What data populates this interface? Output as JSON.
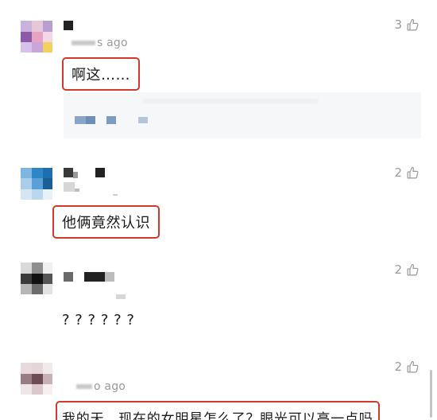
{
  "comments": [
    {
      "time": "s ago",
      "likes": "3",
      "text": "啊这……"
    },
    {
      "time": "",
      "likes": "2",
      "text": "他俩竟然认识"
    },
    {
      "time": "",
      "likes": "2",
      "text": "? ? ? ? ? ?"
    },
    {
      "time": "o ago",
      "likes": "2",
      "text": "我的天，现在的女明星怎么了？眼光可以高一点吗"
    }
  ],
  "colors": {
    "highlight_border": "#d0392b",
    "meta_text": "#9a9a9a",
    "reply_background": "#f6f7f8"
  },
  "icons": {
    "like": "thumbs-up-icon"
  }
}
